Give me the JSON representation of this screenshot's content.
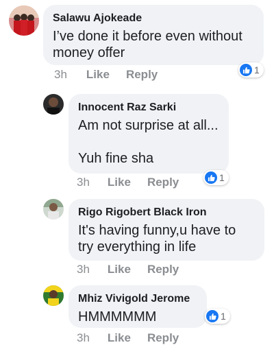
{
  "comments": [
    {
      "author": "Salawu Ajokeade",
      "text": "I’ve done it before even without money offer",
      "time": "3h",
      "like_label": "Like",
      "reply_label": "Reply",
      "reaction_count": "1"
    },
    {
      "author": "Innocent Raz Sarki",
      "text": "Am not surprise at all...\n\nYuh fine sha",
      "time": "3h",
      "like_label": "Like",
      "reply_label": "Reply",
      "reaction_count": "1"
    },
    {
      "author": "Rigo Rigobert Black Iron",
      "text": "It's having funny,u have to try everything in life",
      "time": "3h",
      "like_label": "Like",
      "reply_label": "Reply"
    },
    {
      "author": "Mhiz Vivigold Jerome",
      "text": "HMMMMMM",
      "time": "3h",
      "like_label": "Like",
      "reply_label": "Reply",
      "reaction_count": "1"
    }
  ],
  "icons": {
    "reaction": "like-thumb-icon"
  },
  "colors": {
    "bubble": "#f0f2f5",
    "meta_text": "#8a8d91",
    "like_blue": "#1877f2"
  }
}
